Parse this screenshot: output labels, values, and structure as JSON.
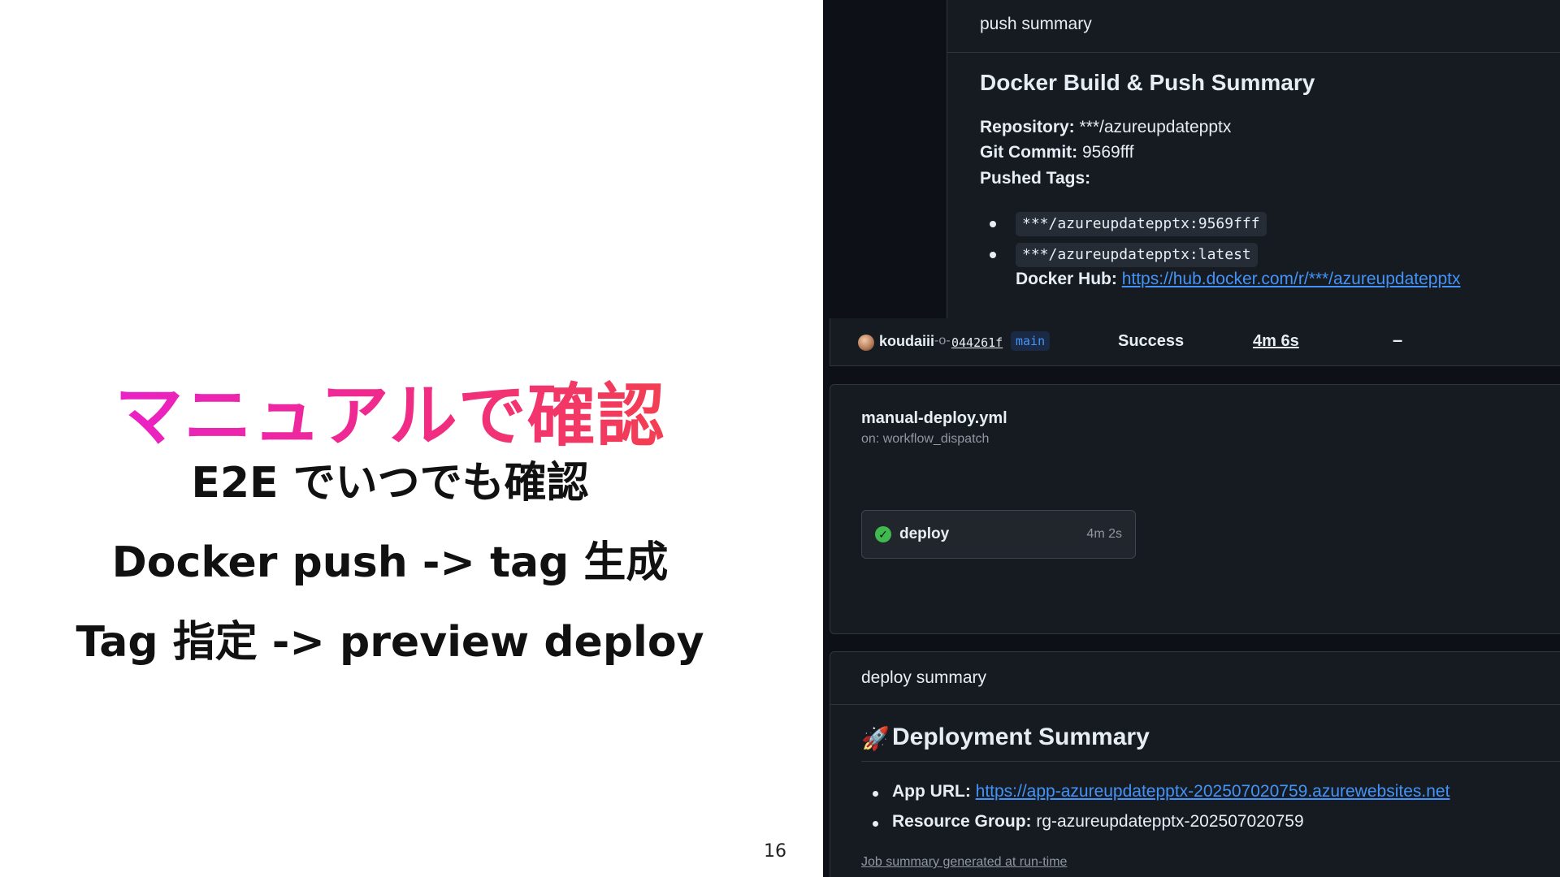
{
  "slide": {
    "title": "マニュアルで確認",
    "lines": [
      "E2E でいつでも確認",
      "Docker push -> tag 生成",
      "Tag 指定 -> preview deploy"
    ],
    "page_number": "16"
  },
  "push_summary": {
    "header": "push summary",
    "heading": "Docker Build & Push Summary",
    "repository_label": "Repository:",
    "repository_value": " ***/azureupdatepptx",
    "commit_label": "Git Commit:",
    "commit_value": " 9569fff",
    "tags_label": "Pushed Tags:",
    "tags": [
      "***/azureupdatepptx:9569fff",
      "***/azureupdatepptx:latest"
    ],
    "hub_label": "Docker Hub:",
    "hub_url": "https://hub.docker.com/r/***/azureupdatepptx"
  },
  "run_row": {
    "user": "koudaiii",
    "commit_icon": "commit-icon",
    "sha": "044261f",
    "branch": "main",
    "status": "Success",
    "duration": "4m 6s",
    "dash": "–"
  },
  "workflow": {
    "file": "manual-deploy.yml",
    "trigger": "on: workflow_dispatch",
    "job": {
      "name": "deploy",
      "time": "4m 2s",
      "status_icon": "check-circle-icon"
    }
  },
  "deploy_summary": {
    "header": "deploy summary",
    "heading_icon": "rocket-icon",
    "heading": "Deployment Summary",
    "app_url_label": "App URL:",
    "app_url": "https://app-azureupdatepptx-202507020759.azurewebsites.net",
    "resource_group_label": "Resource Group:",
    "resource_group_value": " rg-azureupdatepptx-202507020759",
    "footnote": "Job summary generated at run-time"
  },
  "colors": {
    "title_gradient_start": "#e81ee0",
    "title_gradient_end": "#f4473a",
    "panel_bg": "#0d1117",
    "card_bg": "#161b22",
    "link": "#4493f8",
    "success": "#3fb950"
  }
}
